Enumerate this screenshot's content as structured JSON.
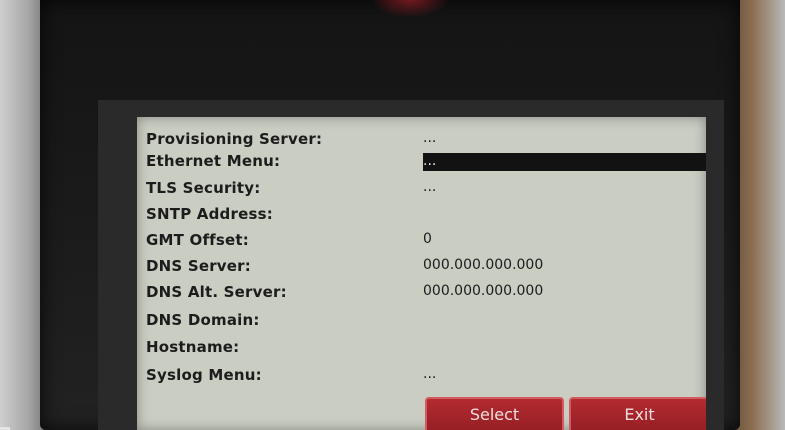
{
  "menu": {
    "rows": [
      {
        "label": "Provisioning Server:",
        "value": "..."
      },
      {
        "label": "Ethernet Menu:",
        "value": "...",
        "selected": true
      },
      {
        "label": "TLS Security:",
        "value": "..."
      },
      {
        "label": "SNTP Address:",
        "value": ""
      },
      {
        "label": "GMT Offset:",
        "value": "0"
      },
      {
        "label": "DNS Server:",
        "value": "000.000.000.000"
      },
      {
        "label": "DNS Alt. Server:",
        "value": "000.000.000.000"
      },
      {
        "label": "DNS Domain:",
        "value": ""
      },
      {
        "label": "Hostname:",
        "value": ""
      },
      {
        "label": "Syslog Menu:",
        "value": "..."
      }
    ]
  },
  "softkeys": {
    "select_label": "Select",
    "exit_label": "Exit"
  },
  "colors": {
    "lcd_background": "#c9cdc2",
    "highlight": "#121212",
    "softkey": "#9e2228"
  }
}
